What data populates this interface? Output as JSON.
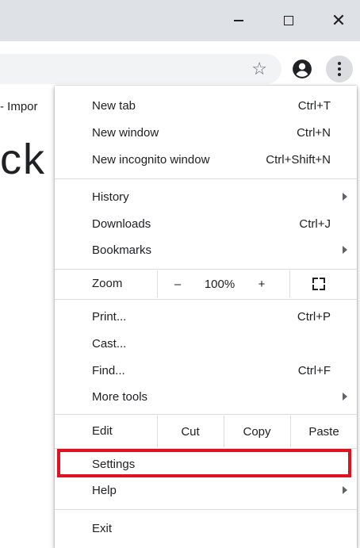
{
  "window": {
    "minimize_icon": "minimize-icon",
    "maximize_icon": "maximize-icon",
    "close_glyph": "✕"
  },
  "toolbar": {
    "star_glyph": "☆",
    "profile_icon": "account-circle-icon",
    "menu_icon": "three-dot-menu-icon"
  },
  "page": {
    "bookmark_fragment": "- Impor",
    "heading_fragment": "ck"
  },
  "menu": {
    "new_tab": {
      "label": "New tab",
      "shortcut": "Ctrl+T"
    },
    "new_window": {
      "label": "New window",
      "shortcut": "Ctrl+N"
    },
    "new_incognito": {
      "label": "New incognito window",
      "shortcut": "Ctrl+Shift+N"
    },
    "history": {
      "label": "History"
    },
    "downloads": {
      "label": "Downloads",
      "shortcut": "Ctrl+J"
    },
    "bookmarks": {
      "label": "Bookmarks"
    },
    "zoom": {
      "label": "Zoom",
      "minus": "–",
      "value": "100%",
      "plus": "+"
    },
    "print": {
      "label": "Print...",
      "shortcut": "Ctrl+P"
    },
    "cast": {
      "label": "Cast..."
    },
    "find": {
      "label": "Find...",
      "shortcut": "Ctrl+F"
    },
    "more_tools": {
      "label": "More tools"
    },
    "edit": {
      "label": "Edit",
      "cut": "Cut",
      "copy": "Copy",
      "paste": "Paste"
    },
    "settings": {
      "label": "Settings"
    },
    "help": {
      "label": "Help"
    },
    "exit": {
      "label": "Exit"
    }
  },
  "colors": {
    "highlight": "#e0121f",
    "titlebar": "#dee1e6",
    "separator": "#dadce0"
  }
}
